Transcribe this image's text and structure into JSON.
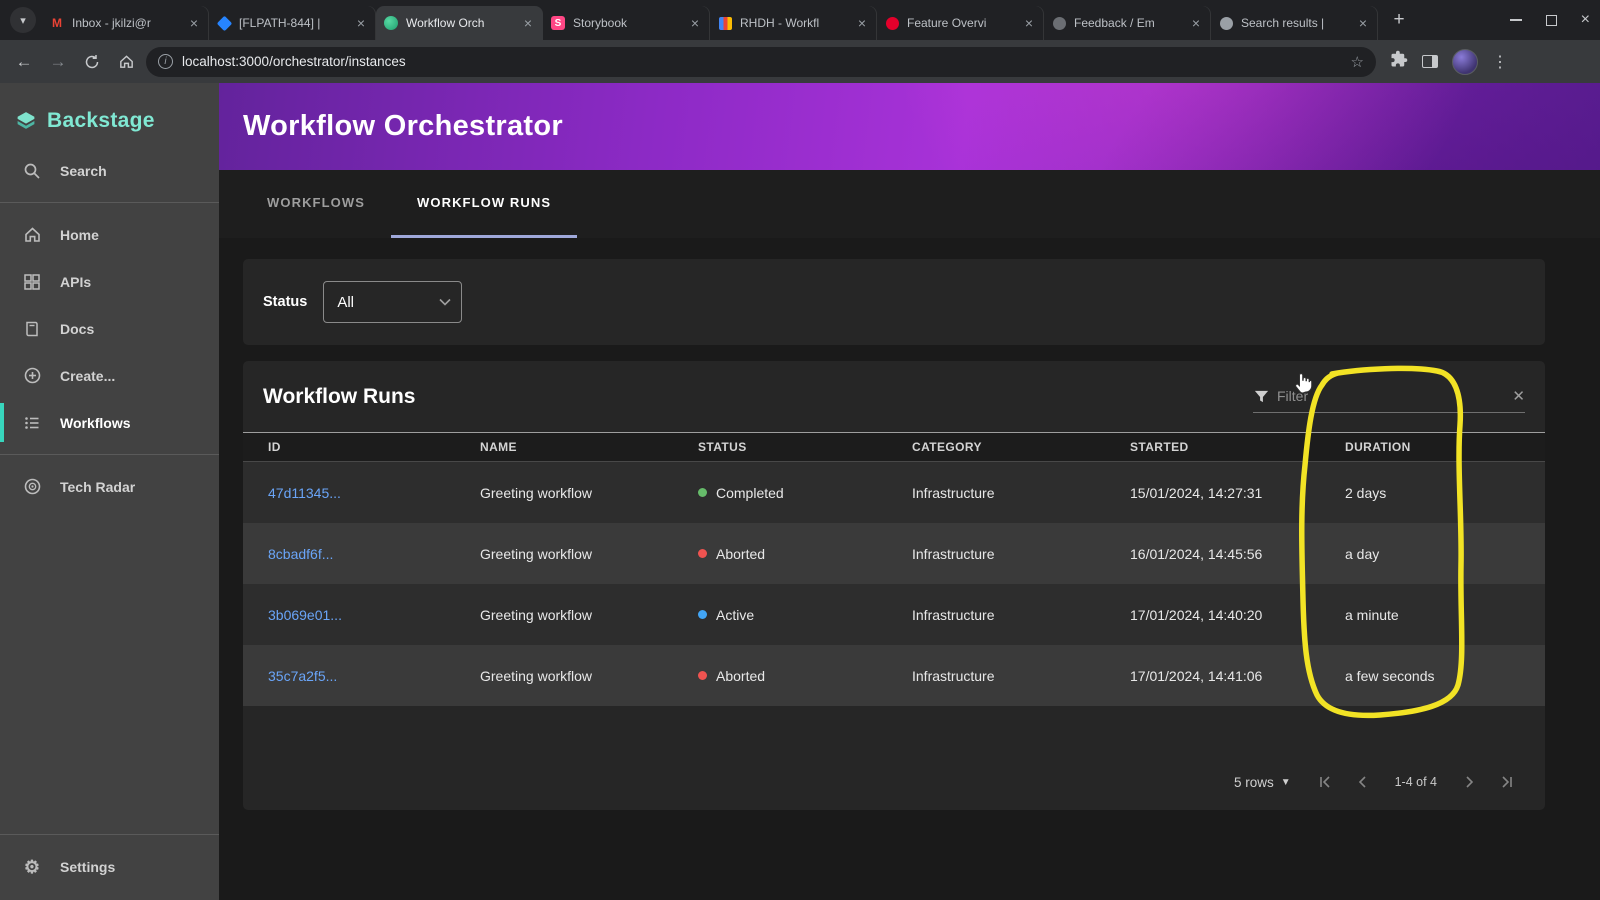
{
  "colors": {
    "logo": "#80e8d3",
    "tab_indicator": "#9fa8da",
    "annotation": "#f2e325"
  },
  "browser": {
    "tab_search_icon": "chevron-down",
    "tabs": [
      {
        "label": "Inbox - jkilzi@r",
        "icon": "gmail"
      },
      {
        "label": "[FLPATH-844] |",
        "icon": "jira"
      },
      {
        "label": "Workflow Orch",
        "icon": "orchestrator",
        "active": true
      },
      {
        "label": "Storybook",
        "icon": "storybook"
      },
      {
        "label": "RHDH - Workfl",
        "icon": "rhdh"
      },
      {
        "label": "Feature Overvi",
        "icon": "feature"
      },
      {
        "label": "Feedback / Em",
        "icon": "feedback"
      },
      {
        "label": "Search results |",
        "icon": "search-results"
      }
    ],
    "url": "localhost:3000/orchestrator/instances"
  },
  "sidebar": {
    "logo": "Backstage",
    "search": "Search",
    "items": [
      {
        "label": "Home"
      },
      {
        "label": "APIs"
      },
      {
        "label": "Docs"
      },
      {
        "label": "Create..."
      },
      {
        "label": "Workflows",
        "active": true
      },
      {
        "label": "Tech Radar"
      }
    ],
    "settings": "Settings"
  },
  "header": {
    "title": "Workflow Orchestrator"
  },
  "page_tabs": [
    {
      "label": "WORKFLOWS"
    },
    {
      "label": "WORKFLOW RUNS",
      "active": true
    }
  ],
  "filters": {
    "status_label": "Status",
    "status_value": "All"
  },
  "runs": {
    "title": "Workflow Runs",
    "filter_placeholder": "Filter",
    "columns": [
      "ID",
      "NAME",
      "STATUS",
      "CATEGORY",
      "STARTED",
      "DURATION"
    ],
    "rows": [
      {
        "id": "47d11345...",
        "name": "Greeting workflow",
        "status": "Completed",
        "status_color": "#66bb6a",
        "category": "Infrastructure",
        "started": "15/01/2024, 14:27:31",
        "duration": "2 days"
      },
      {
        "id": "8cbadf6f...",
        "name": "Greeting workflow",
        "status": "Aborted",
        "status_color": "#ef5350",
        "category": "Infrastructure",
        "started": "16/01/2024, 14:45:56",
        "duration": "a day"
      },
      {
        "id": "3b069e01...",
        "name": "Greeting workflow",
        "status": "Active",
        "status_color": "#42a5f5",
        "category": "Infrastructure",
        "started": "17/01/2024, 14:40:20",
        "duration": "a minute"
      },
      {
        "id": "35c7a2f5...",
        "name": "Greeting workflow",
        "status": "Aborted",
        "status_color": "#ef5350",
        "category": "Infrastructure",
        "started": "17/01/2024, 14:41:06",
        "duration": "a few seconds"
      }
    ],
    "footer": {
      "rows_label": "5 rows",
      "range": "1-4 of 4"
    }
  }
}
